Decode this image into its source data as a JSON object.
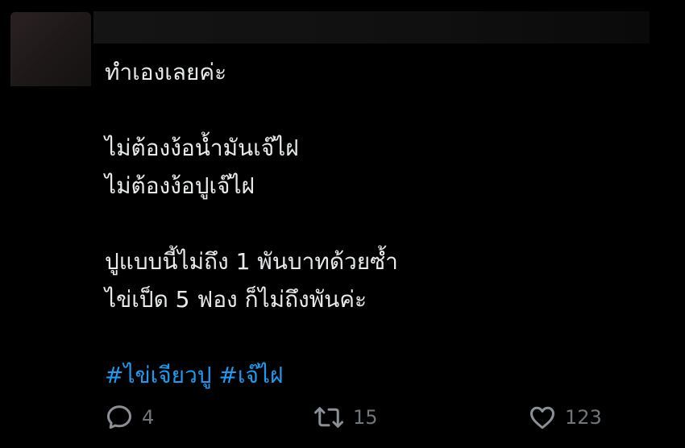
{
  "tweet": {
    "lines": [
      "ทำเองเลยค่ะ",
      "ไม่ต้องง้อน้ำมันเจ๊ไฝ",
      "ไม่ต้องง้อปูเจ๊ไฝ",
      "ปูแบบนี้ไม่ถึง 1 พันบาทด้วยซ้ำ",
      "ไข่เป็ด 5 ฟอง ก็ไม่ถึงพันค่ะ"
    ],
    "hashtags": [
      "#ไข่เจียวปู",
      "#เจ๊ไฝ"
    ]
  },
  "actions": {
    "reply_count": "4",
    "retweet_count": "15",
    "like_count": "123",
    "reply_icon": "reply-icon",
    "retweet_icon": "retweet-icon",
    "like_icon": "heart-icon"
  },
  "colors": {
    "background": "#000000",
    "text": "#e7e9ea",
    "hashtag": "#1d9bf0",
    "muted": "#71767b"
  }
}
